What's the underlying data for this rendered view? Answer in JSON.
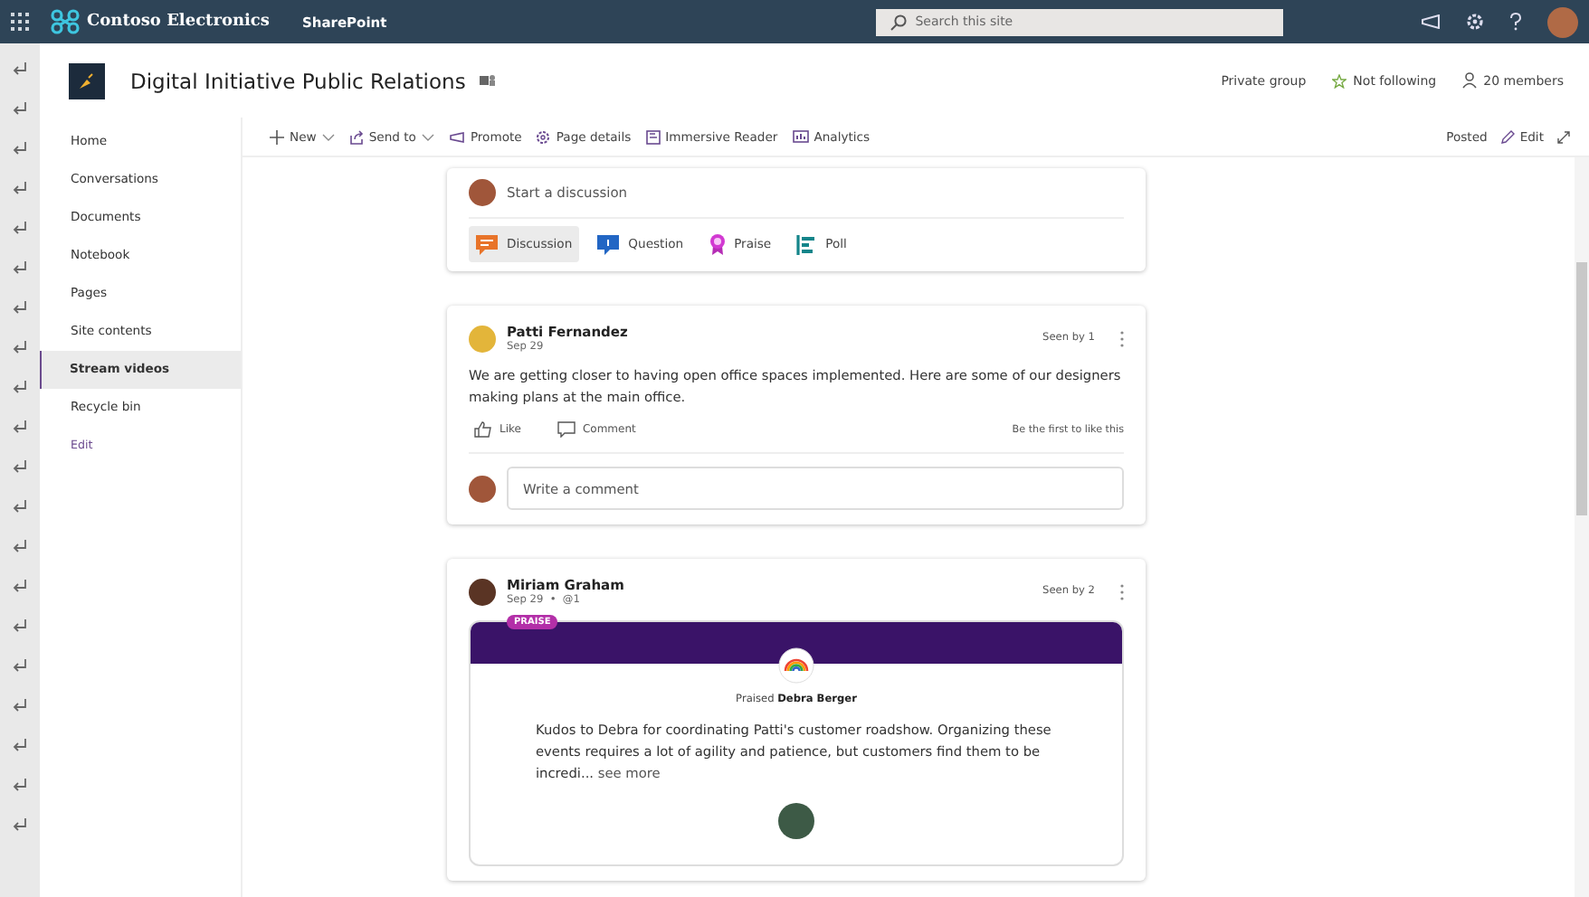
{
  "topbar": {
    "org": "Contoso Electronics",
    "app": "SharePoint",
    "search": {
      "placeholder": "Search this site"
    }
  },
  "site": {
    "title": "Digital Initiative Public Relations",
    "privacy": "Private group",
    "follow": "Not following",
    "members": "20 members"
  },
  "nav": [
    {
      "label": "Home",
      "selected": false
    },
    {
      "label": "Conversations",
      "selected": false
    },
    {
      "label": "Documents",
      "selected": false
    },
    {
      "label": "Notebook",
      "selected": false
    },
    {
      "label": "Pages",
      "selected": false
    },
    {
      "label": "Site contents",
      "selected": false
    },
    {
      "label": "Stream videos",
      "selected": true
    },
    {
      "label": "Recycle bin",
      "selected": false
    }
  ],
  "nav_edit": "Edit",
  "commands": [
    {
      "label": "New",
      "kind": "plus",
      "menu": true
    },
    {
      "label": "Send to",
      "kind": "send",
      "menu": true
    },
    {
      "label": "Promote",
      "kind": "promote",
      "menu": false
    },
    {
      "label": "Page details",
      "kind": "gear",
      "menu": false
    },
    {
      "label": "Immersive Reader",
      "kind": "reader",
      "menu": false
    },
    {
      "label": "Analytics",
      "kind": "chart",
      "menu": false
    }
  ],
  "command_right": {
    "status": "Posted",
    "edit": "Edit"
  },
  "composer": {
    "placeholder": "Start a discussion",
    "types": [
      {
        "label": "Discussion",
        "kind": "discussion",
        "selected": true
      },
      {
        "label": "Question",
        "kind": "question",
        "selected": false
      },
      {
        "label": "Praise",
        "kind": "praise",
        "selected": false
      },
      {
        "label": "Poll",
        "kind": "poll",
        "selected": false
      }
    ]
  },
  "posts": [
    {
      "kind": "text",
      "author": "Patti Fernandez",
      "meta": "Sep 29",
      "seen": "Seen by 1",
      "body": "We are getting closer to having open office spaces implemented. Here are some of our designers making plans at the main office.",
      "like": "Like",
      "comment": "Comment",
      "likes_note": "Be the first to like this",
      "reply_placeholder": "Write a comment"
    },
    {
      "kind": "praise",
      "author": "Miriam Graham",
      "meta": "Sep 29  •  @1",
      "seen": "Seen by 2",
      "badge": "PRAISE",
      "praised_label": "Praised",
      "praised_name": "Debra Berger",
      "body": "Kudos to Debra for coordinating Patti's customer roadshow. Organizing these events requires a lot of agility and patience, but customers find them to be incredi...",
      "more": "see more"
    }
  ]
}
